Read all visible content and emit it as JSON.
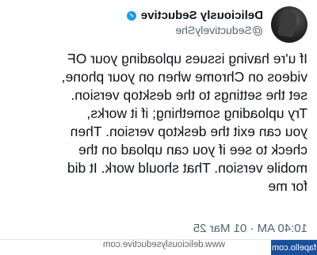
{
  "tweet": {
    "display_name": "Deliciously Seductive",
    "handle": "@SeductivelyShe",
    "verified_icon": "verified-check-icon",
    "body": "If u're having issues uploading your OF\nvideos on Chrome when on your phone,\nset the settings to the desktop version.\nTry uploading something; if it works,\nyou can exit the desktop version. Then\ncheck to see if you can upload on the\nmobile version. That should work. It did\nfor me",
    "timestamp": "10:40 AM · 01 Mar 25"
  },
  "watermark": {
    "site": "www.deliciouslyseductive.com",
    "corner": "fapello.com"
  },
  "colors": {
    "text": "#0f1419",
    "muted": "#536471",
    "verified": "#1d9bf0",
    "corner_badge": "#1a4f9c"
  }
}
